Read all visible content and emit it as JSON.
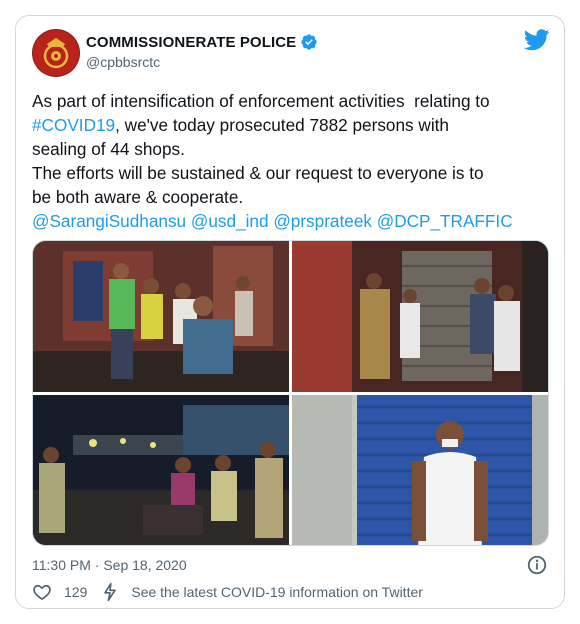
{
  "account": {
    "name": "COMMISSIONERATE POLICE",
    "handle": "@cpbbsrctc",
    "verified": true
  },
  "tweet": {
    "line1": "As part of intensification of enforcement activities  relating to",
    "hashtag": "#COVID19",
    "line2_rest": ", we've today prosecuted 7882 persons with",
    "line3": "sealing of 44 shops.",
    "line4": "The efforts will be sustained & our request to everyone is to",
    "line5": "be both aware & cooperate.",
    "mentions": [
      "@SarangiSudhansu",
      "@usd_ind",
      "@prsprateek",
      "@DCP_TRAFFIC"
    ]
  },
  "timestamp": "11:30 PM · Sep 18, 2020",
  "footer": {
    "likes": "129",
    "covid_info": "See the latest COVID-19 information on Twitter"
  },
  "colors": {
    "link": "#1d9bf0",
    "text": "#0f1419",
    "muted": "#536471",
    "border": "#cfd9de"
  },
  "icons": [
    "verified-badge-icon",
    "twitter-bird-icon",
    "info-icon",
    "heart-icon",
    "lightning-icon"
  ]
}
